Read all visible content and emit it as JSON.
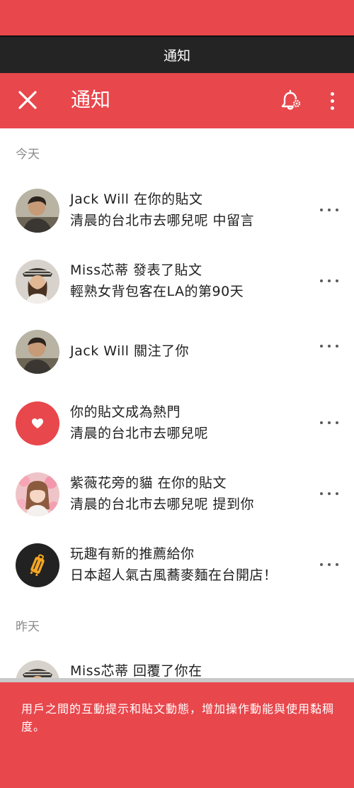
{
  "status_bar": {
    "title": "通知"
  },
  "app_bar": {
    "title": "通知",
    "icons": [
      "close-icon",
      "bell-settings-icon",
      "more-vertical-icon"
    ]
  },
  "sections": [
    {
      "label": "今天"
    },
    {
      "label": "昨天"
    }
  ],
  "notifications": [
    {
      "line1": "Jack Will 在你的貼文",
      "line2": "清晨的台北市去哪兒呢 中留言",
      "avatar": "avatar-jack"
    },
    {
      "line1": "Miss芯蒂 發表了貼文",
      "line2": "輕熟女背包客在LA的第90天",
      "avatar": "avatar-miss"
    },
    {
      "line1": "Jack Will 關注了你",
      "line2": "",
      "avatar": "avatar-jack"
    },
    {
      "line1": "你的貼文成為熱門",
      "line2": "清晨的台北市去哪兒呢",
      "avatar": "heart-icon"
    },
    {
      "line1": "紫薇花旁的貓 在你的貼文",
      "line2": "清晨的台北市去哪兒呢 提到你",
      "avatar": "avatar-cat"
    },
    {
      "line1": "玩趣有新的推薦給你",
      "line2": "日本超人氣古風蕎麥麵在台開店！",
      "avatar": "luggage-icon"
    },
    {
      "line1": "Miss芯蒂 回覆了你在",
      "line2": "",
      "avatar": "avatar-miss"
    }
  ],
  "caption": "用戶之間的互動提示和貼文動態，增加操作動能與使用黏稠度。",
  "colors": {
    "accent": "#e8474c",
    "status_bar": "#242424",
    "dark_avatar": "#222222"
  }
}
